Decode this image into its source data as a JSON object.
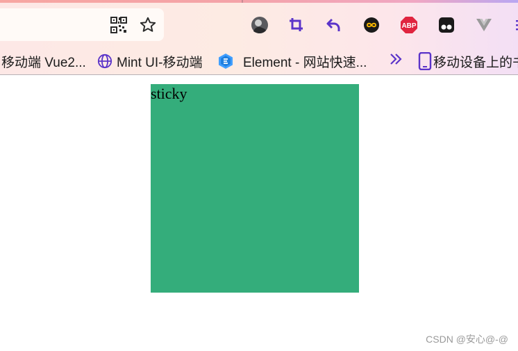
{
  "bookmarks": [
    {
      "label": "移动端 Vue2...",
      "icon": "none"
    },
    {
      "label": "Mint UI-移动端",
      "icon": "globe-icon"
    },
    {
      "label": "Element - 网站快速...",
      "icon": "element-logo-icon"
    },
    {
      "label": "移动设备上的书",
      "icon": "mobile-device-icon"
    }
  ],
  "toolbar": {
    "abp_label": "ABP"
  },
  "content": {
    "sticky_text": "sticky",
    "box_color": "#34ad7b"
  },
  "watermark": "CSDN @安心@-@"
}
